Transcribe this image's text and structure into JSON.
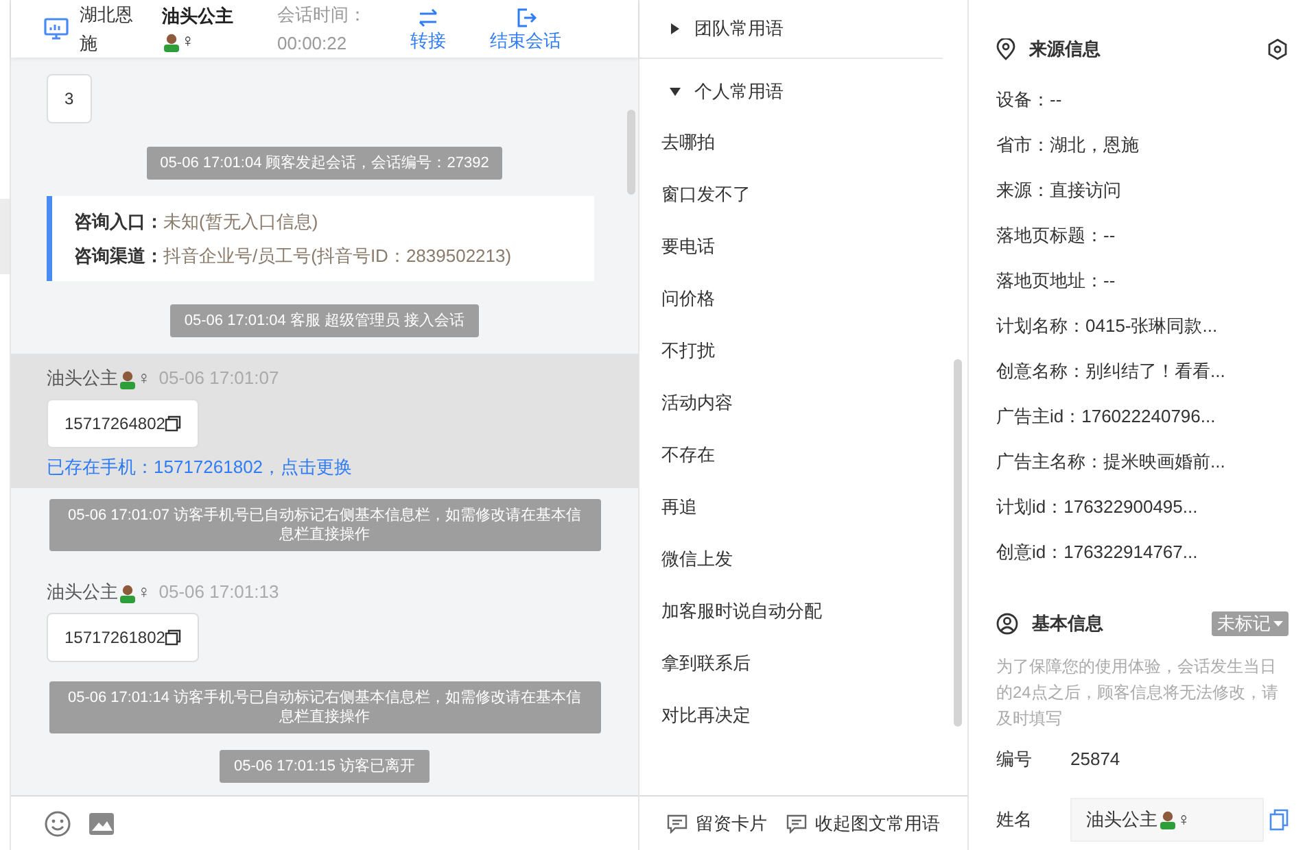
{
  "header": {
    "location": "湖北恩施",
    "visitor_name": "油头公主",
    "visitor_gender": "♀",
    "timer_label": "会话时间：",
    "timer_value": "00:00:22",
    "actions": [
      {
        "kind": "transfer",
        "label": "转接"
      },
      {
        "kind": "end",
        "label": "结束会话"
      }
    ]
  },
  "messages": [
    {
      "kind": "bubble",
      "text": "3"
    },
    {
      "kind": "system",
      "text": "05-06 17:01:04 顾客发起会话，会话编号：27392"
    },
    {
      "kind": "entry",
      "rows": [
        {
          "label": "咨询入口：",
          "value": "未知(暂无入口信息)"
        },
        {
          "label": "咨询渠道：",
          "value": "抖音企业号/员工号(抖音号ID：2839502213)"
        }
      ]
    },
    {
      "kind": "system",
      "text": "05-06 17:01:04 客服 超级管理员 接入会话"
    },
    {
      "kind": "customer",
      "selected": true,
      "name": "油头公主",
      "gender": "♀",
      "time": "05-06 17:01:07",
      "phone": "15717264802",
      "link": "已存在手机：15717261802，点击更换"
    },
    {
      "kind": "system",
      "text": "05-06 17:01:07 访客手机号已自动标记右侧基本信息栏，如需修改请在基本信息栏直接操作"
    },
    {
      "kind": "customer",
      "selected": false,
      "name": "油头公主",
      "gender": "♀",
      "time": "05-06 17:01:13",
      "phone": "15717261802"
    },
    {
      "kind": "system",
      "text": "05-06 17:01:14 访客手机号已自动标记右侧基本信息栏，如需修改请在基本信息栏直接操作"
    },
    {
      "kind": "system",
      "text": "05-06 17:01:15 访客已离开"
    }
  ],
  "phrase_groups": [
    {
      "title": "团队常用语",
      "expanded": false
    },
    {
      "title": "个人常用语",
      "expanded": true,
      "items": [
        "去哪拍",
        "窗口发不了",
        "要电话",
        "问价格",
        "不打扰",
        "活动内容",
        "不存在",
        "再追",
        "微信上发",
        "加客服时说自动分配",
        "拿到联系后",
        "对比再决定"
      ]
    }
  ],
  "footer": {
    "actions": [
      "留资卡片",
      "收起图文常用语"
    ]
  },
  "source_info": {
    "title": "来源信息",
    "items": [
      "设备：--",
      "省市：湖北，恩施",
      "来源：直接访问",
      "落地页标题：--",
      "落地页地址：--",
      "计划名称：0415-张琳同款...",
      "创意名称：别纠结了！看看...",
      "广告主id：176022240796...",
      "广告主名称：提米映画婚前...",
      "计划id：176322900495...",
      "创意id：176322914767..."
    ]
  },
  "basic_info": {
    "title": "基本信息",
    "tag": "未标记",
    "note": "为了保障您的使用体验，会话发生当日的24点之后，顾客信息将无法修改，请及时填写",
    "fields": [
      {
        "kind": "text",
        "label": "编号",
        "value": "25874"
      },
      {
        "kind": "input",
        "label": "姓名",
        "value": "油头公主",
        "gender": "♀"
      }
    ]
  }
}
